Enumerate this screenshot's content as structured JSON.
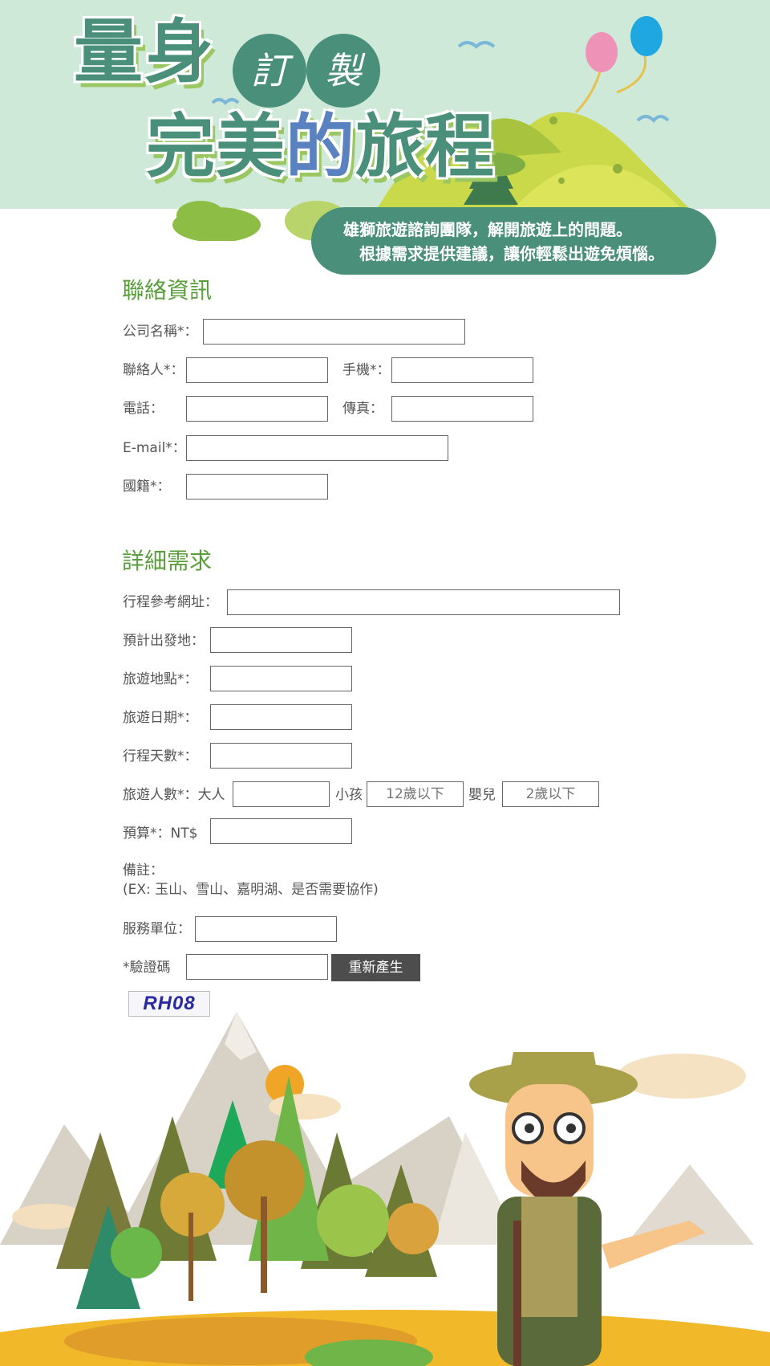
{
  "header": {
    "title_line1": "量身",
    "title_circles": [
      "訂",
      "製"
    ],
    "title_line2_a": "完美",
    "title_line2_b": "的",
    "title_line2_c": "旅程",
    "banner_line1": "雄獅旅遊諮詢團隊，解開旅遊上的問題。",
    "banner_line2": "根據需求提供建議，讓你輕鬆出遊免煩惱。"
  },
  "contact": {
    "section_title": "聯絡資訊",
    "company_label": "公司名稱*：",
    "contact_person_label": "聯絡人*：",
    "mobile_label": "手機*：",
    "phone_label": "電話：",
    "fax_label": "傳真：",
    "email_label": "E-mail*：",
    "nationality_label": "國籍*："
  },
  "details": {
    "section_title": "詳細需求",
    "itinerary_url_label": "行程參考網址：",
    "departure_label": "預計出發地：",
    "destination_label": "旅遊地點*：",
    "date_label": "旅遊日期*：",
    "days_label": "行程天數*：",
    "people_label": "旅遊人數*：大人",
    "child_label": "小孩",
    "child_placeholder": "12歲以下",
    "infant_label": "嬰兒",
    "infant_placeholder": "2歲以下",
    "budget_label": "預算*：NT$",
    "remarks_label": "備註：",
    "remarks_hint": "(EX: 玉山、雪山、嘉明湖、是否需要協作)",
    "service_unit_label": "服務單位：",
    "captcha_label": "*驗證碼",
    "regenerate_button": "重新產生",
    "captcha_code": "RH08"
  },
  "colors": {
    "header_bg": "#cfe9d8",
    "brand_green": "#4a8f7a",
    "section_title_green": "#5a9e3c",
    "button_dark": "#4d4d4d"
  }
}
